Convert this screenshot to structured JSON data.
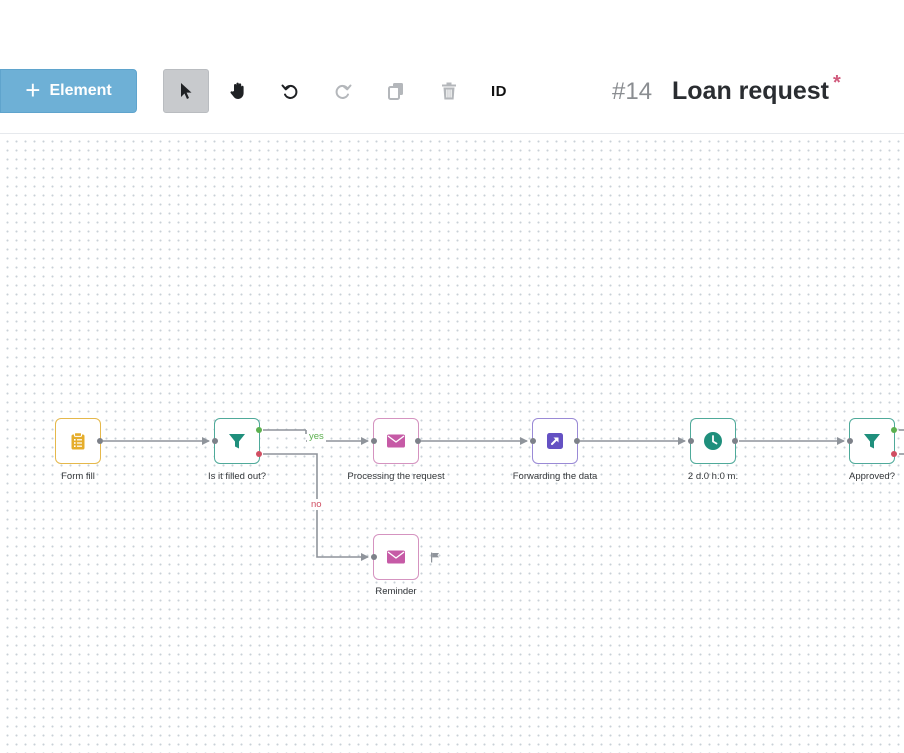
{
  "toolbar": {
    "add_button": {
      "label": "Element",
      "icon": "plus-icon"
    },
    "tools": [
      {
        "name": "select",
        "icon": "cursor-arrow-icon",
        "active": true
      },
      {
        "name": "pan",
        "icon": "hand-icon",
        "active": false
      },
      {
        "name": "undo",
        "icon": "undo-icon",
        "active": false
      },
      {
        "name": "redo",
        "icon": "redo-icon",
        "active": false,
        "disabled": true
      },
      {
        "name": "copy",
        "icon": "copy-icon",
        "active": false,
        "disabled": true
      },
      {
        "name": "delete",
        "icon": "trash-icon",
        "active": false,
        "disabled": true
      },
      {
        "name": "id",
        "label": "ID"
      }
    ],
    "id_label": "ID"
  },
  "process": {
    "number": "#14",
    "title": "Loan request",
    "unsaved_mark": "*"
  },
  "workflow": {
    "nodes": [
      {
        "id": "form-fill",
        "label": "Form fill",
        "type": "form",
        "icon": "clipboard-icon",
        "color": "#e5ad2b"
      },
      {
        "id": "is-filled",
        "label": "Is it filled out?",
        "type": "filter",
        "icon": "funnel-icon",
        "color": "#1f8f7c"
      },
      {
        "id": "processing",
        "label": "Processing the request",
        "type": "mail",
        "icon": "envelope-icon",
        "color": "#c65aa6"
      },
      {
        "id": "forwarding",
        "label": "Forwarding the data",
        "type": "forward",
        "icon": "arrow-up-right-icon",
        "color": "#6451c3"
      },
      {
        "id": "timer",
        "label": "2 d.0 h.0 m.",
        "type": "timer",
        "icon": "clock-icon",
        "color": "#1f8f7c"
      },
      {
        "id": "approved",
        "label": "Approved?",
        "type": "filter",
        "icon": "funnel-icon",
        "color": "#1f8f7c"
      },
      {
        "id": "reminder",
        "label": "Reminder",
        "type": "mail",
        "icon": "envelope-icon",
        "color": "#c65aa6"
      }
    ],
    "edge_labels": {
      "yes": "yes",
      "no": "no"
    },
    "end_marker_icon": "flag-icon"
  }
}
